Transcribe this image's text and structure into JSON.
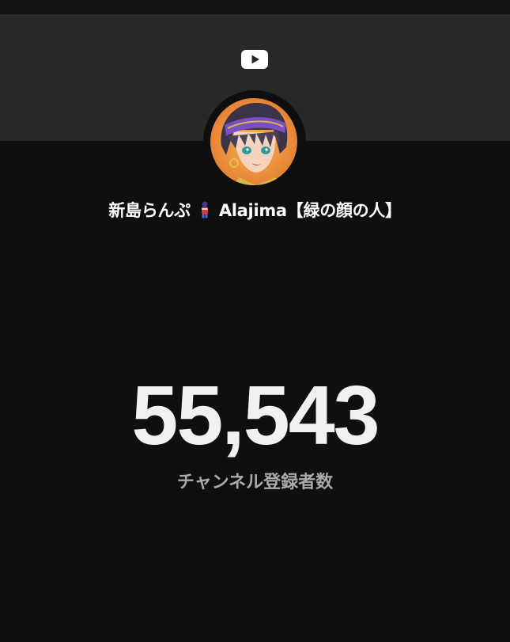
{
  "header": {
    "logo_icon": "youtube-logo-icon"
  },
  "channel": {
    "name_part1": "新島らんぷ",
    "name_emoji": "standing-figure-emoji",
    "name_part2": "Alajima【緑の顔の人】",
    "avatar_icon": "channel-avatar"
  },
  "stats": {
    "subscriber_count": "55,543",
    "subscriber_label": "チャンネル登録者数"
  },
  "colors": {
    "background": "#0f0f0f",
    "banner": "#282828",
    "count_text": "#f1f1f1",
    "label_text": "#aaaaaa"
  }
}
